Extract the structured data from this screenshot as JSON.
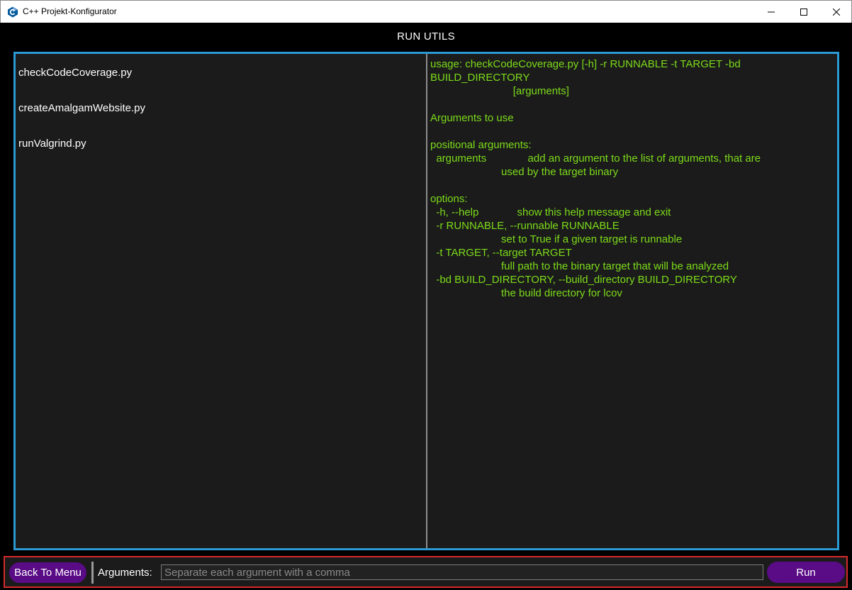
{
  "window": {
    "title": "C++ Projekt-Konfigurator",
    "icon": "cpp-logo-icon"
  },
  "header": {
    "title": "RUN UTILS"
  },
  "scripts": [
    {
      "label": "checkCodeCoverage.py"
    },
    {
      "label": "createAmalgamWebsite.py"
    },
    {
      "label": "runValgrind.py"
    }
  ],
  "help": {
    "text": "usage: checkCodeCoverage.py [-h] -r RUNNABLE -t TARGET -bd\nBUILD_DIRECTORY\n                            [arguments]\n\nArguments to use\n\npositional arguments:\n  arguments              add an argument to the list of arguments, that are\n                        used by the target binary\n\noptions:\n  -h, --help             show this help message and exit\n  -r RUNNABLE, --runnable RUNNABLE\n                        set to True if a given target is runnable\n  -t TARGET, --target TARGET\n                        full path to the binary target that will be analyzed\n  -bd BUILD_DIRECTORY, --build_directory BUILD_DIRECTORY\n                        the build directory for lcov"
  },
  "bottom": {
    "back_label": "Back To Menu",
    "args_label": "Arguments:",
    "args_value": "",
    "args_placeholder": "Separate each argument with a comma",
    "run_label": "Run"
  },
  "colors": {
    "accent_border": "#2b9ad3",
    "help_text": "#7cdb1a",
    "button_bg": "#5a0b86",
    "bottom_border": "#d42a2a"
  }
}
